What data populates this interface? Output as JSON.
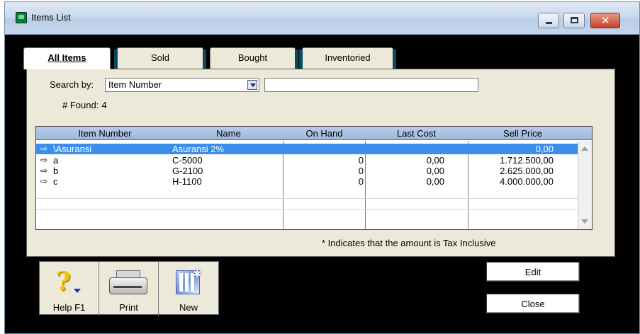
{
  "window": {
    "title": "Items List",
    "app_icon": "green-list-icon",
    "controls": {
      "minimize_icon": "minimize-icon",
      "maximize_icon": "maximize-icon",
      "close_icon": "close-icon",
      "close_glyph": "✕"
    }
  },
  "tabs": [
    {
      "label": "All Items",
      "active": true
    },
    {
      "label": "Sold",
      "active": false
    },
    {
      "label": "Bought",
      "active": false
    },
    {
      "label": "Inventoried",
      "active": false
    }
  ],
  "search": {
    "label": "Search by:",
    "field_value": "Item Number",
    "text_value": "",
    "found_label": "# Found:",
    "found_count": "4"
  },
  "table": {
    "columns": [
      "Item Number",
      "Name",
      "On Hand",
      "Last Cost",
      "Sell Price"
    ],
    "row_arrow": "⇨",
    "rows": [
      {
        "item_number": "\\Asuransi",
        "name": "Asuransi 2%",
        "on_hand": "",
        "last_cost": "",
        "sell_price": "0,00",
        "selected": true
      },
      {
        "item_number": "a",
        "name": "C-5000",
        "on_hand": "0",
        "last_cost": "0,00",
        "sell_price": "1.712.500,00",
        "selected": false
      },
      {
        "item_number": "b",
        "name": "G-2100",
        "on_hand": "0",
        "last_cost": "0,00",
        "sell_price": "2.625.000,00",
        "selected": false
      },
      {
        "item_number": "c",
        "name": "H-1100",
        "on_hand": "0",
        "last_cost": "0,00",
        "sell_price": "4.000.000,00",
        "selected": false
      }
    ]
  },
  "tax_note": "* Indicates that the amount is Tax Inclusive",
  "toolbar": {
    "help_label": "Help F1",
    "print_label": "Print",
    "new_label": "New"
  },
  "buttons": {
    "edit_label": "Edit",
    "close_label": "Close"
  },
  "colors": {
    "selection": "#3b8eea",
    "window_background": "#000000",
    "panel_background": "#ece9d8",
    "header_background": "#b9cde8"
  }
}
